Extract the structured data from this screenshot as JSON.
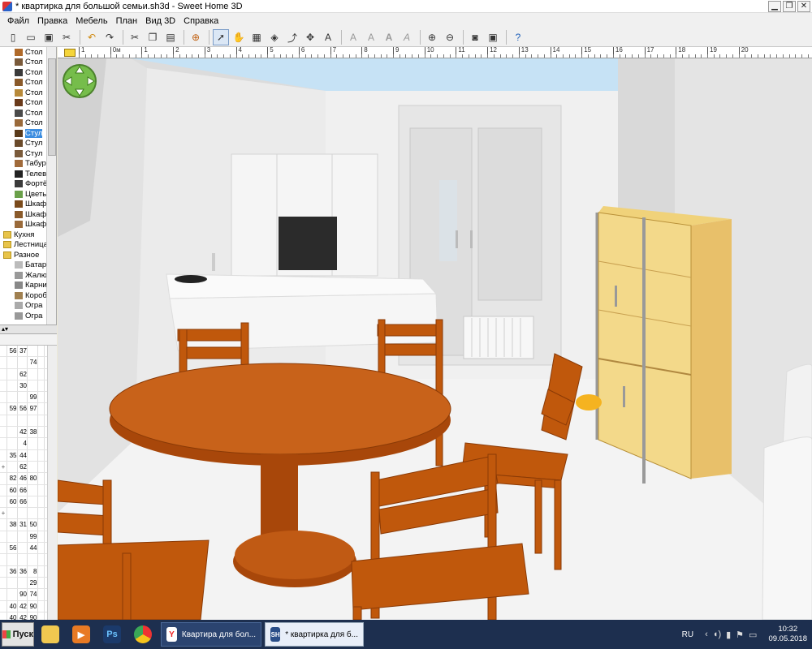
{
  "window": {
    "title": "* квартирка для большой семьи.sh3d - Sweet Home 3D",
    "minimize": "▁",
    "restore": "❐",
    "close": "✕"
  },
  "menu": [
    "Файл",
    "Правка",
    "Мебель",
    "План",
    "Вид 3D",
    "Справка"
  ],
  "toolbar": {
    "buttons": [
      "new",
      "open",
      "save",
      "cut-scissors",
      "undo",
      "redo",
      "cut",
      "copy",
      "paste",
      "add-furniture",
      "select",
      "pan",
      "create-walls",
      "create-rooms",
      "create-polylines",
      "create-dimensions",
      "add-text",
      "text-style-1",
      "text-style-2",
      "text-style-3",
      "text-style-4",
      "zoom-in",
      "zoom-out",
      "photo",
      "video",
      "help"
    ]
  },
  "catalog": {
    "items": [
      {
        "label": "Стол",
        "type": "item"
      },
      {
        "label": "Стол",
        "type": "item"
      },
      {
        "label": "Стол",
        "type": "item"
      },
      {
        "label": "Стол",
        "type": "item"
      },
      {
        "label": "Стол",
        "type": "item"
      },
      {
        "label": "Стол",
        "type": "item"
      },
      {
        "label": "Стол",
        "type": "item"
      },
      {
        "label": "Стол",
        "type": "item"
      },
      {
        "label": "Стул",
        "type": "item",
        "selected": true
      },
      {
        "label": "Стул",
        "type": "item"
      },
      {
        "label": "Стул",
        "type": "item"
      },
      {
        "label": "Табур",
        "type": "item"
      },
      {
        "label": "Телев",
        "type": "item"
      },
      {
        "label": "Фортё",
        "type": "item"
      },
      {
        "label": "Цветы",
        "type": "item"
      },
      {
        "label": "Шкаф",
        "type": "item"
      },
      {
        "label": "Шкаф",
        "type": "item"
      },
      {
        "label": "Шкаф",
        "type": "item"
      },
      {
        "label": "Кухня",
        "type": "folder"
      },
      {
        "label": "Лестница",
        "type": "folder"
      },
      {
        "label": "Разное",
        "type": "folder"
      },
      {
        "label": "Батар",
        "type": "item"
      },
      {
        "label": "Жалю",
        "type": "item"
      },
      {
        "label": "Карни",
        "type": "item"
      },
      {
        "label": "Короб",
        "type": "item"
      },
      {
        "label": "Огра",
        "type": "item"
      },
      {
        "label": "Огра",
        "type": "item"
      }
    ]
  },
  "furniture_table": {
    "rows": [
      [
        "",
        "56",
        "37",
        ""
      ],
      [
        "",
        "",
        "",
        "74"
      ],
      [
        "",
        "",
        "62",
        ""
      ],
      [
        "",
        "",
        "30",
        ""
      ],
      [
        "",
        "",
        "",
        "99"
      ],
      [
        "",
        "59",
        "56",
        "97"
      ],
      [
        "",
        "",
        "",
        ""
      ],
      [
        "",
        "",
        "42",
        "38"
      ],
      [
        "",
        "",
        "4",
        ""
      ],
      [
        "",
        "35",
        "44",
        ""
      ],
      [
        "+",
        "",
        "62",
        ""
      ],
      [
        "",
        "82",
        "46",
        "80"
      ],
      [
        "",
        "60",
        "66",
        ""
      ],
      [
        "",
        "60",
        "66",
        ""
      ],
      [
        "+",
        "",
        "",
        ""
      ],
      [
        "",
        "38",
        "31",
        "50"
      ],
      [
        "",
        "",
        "",
        "99"
      ],
      [
        "",
        "56",
        "",
        "44"
      ],
      [
        "",
        "",
        "",
        ""
      ],
      [
        "",
        "36",
        "36",
        "8"
      ],
      [
        "",
        "",
        "",
        "29"
      ],
      [
        "",
        "",
        "90",
        "74"
      ],
      [
        "",
        "40",
        "42",
        "90"
      ],
      [
        "",
        "40",
        "42",
        "90"
      ],
      [
        "",
        "40",
        "42",
        "90"
      ]
    ]
  },
  "ruler": {
    "labels": [
      "1",
      "0м",
      "1",
      "2",
      "3",
      "4",
      "5",
      "6",
      "7",
      "8",
      "9",
      "10",
      "11",
      "12",
      "13",
      "14",
      "15",
      "16",
      "17",
      "18",
      "19",
      "20"
    ]
  },
  "taskbar": {
    "start_label": "Пуск",
    "pinned": [
      "explorer",
      "media-player",
      "photoshop",
      "chrome"
    ],
    "pinned_glyphs": {
      "photoshop": "Ps"
    },
    "tasks": [
      {
        "label": "Квартира для бол...",
        "icon": "Y",
        "active": false
      },
      {
        "label": "* квартирка для б...",
        "icon": "SH",
        "active": true
      }
    ],
    "language": "RU",
    "time": "10:32",
    "date": "09.05.2018"
  }
}
